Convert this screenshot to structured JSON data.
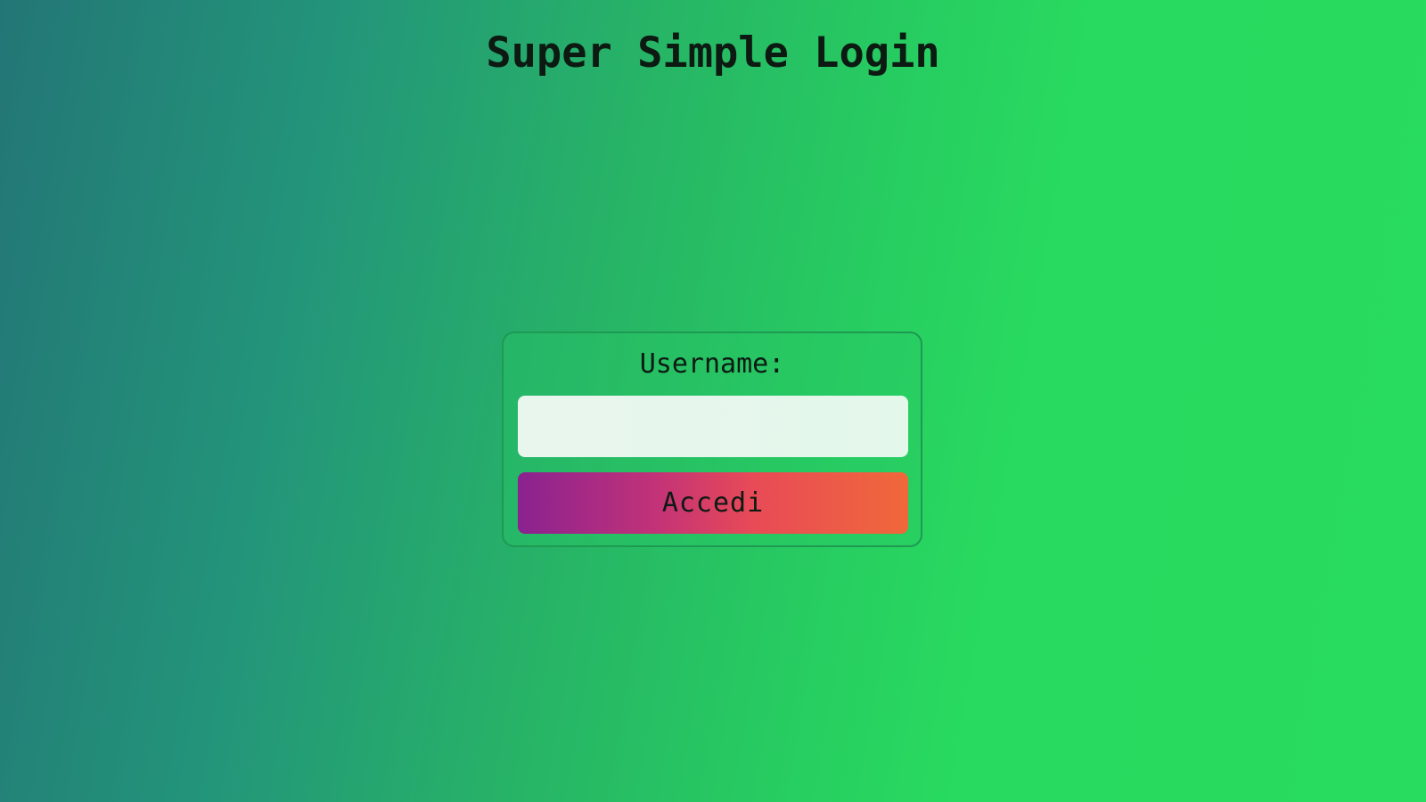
{
  "page": {
    "title": "Super Simple Login"
  },
  "login_form": {
    "username_label": "Username:",
    "username_value": "",
    "username_placeholder": "",
    "submit_label": "Accedi"
  },
  "colors": {
    "background_start": "#237676",
    "background_end": "#28dc5f",
    "button_gradient_start": "#8a2290",
    "button_gradient_mid": "#e84a57",
    "button_gradient_end": "#f0683a",
    "input_background": "#e9f6ee",
    "text": "#0c1a12"
  }
}
